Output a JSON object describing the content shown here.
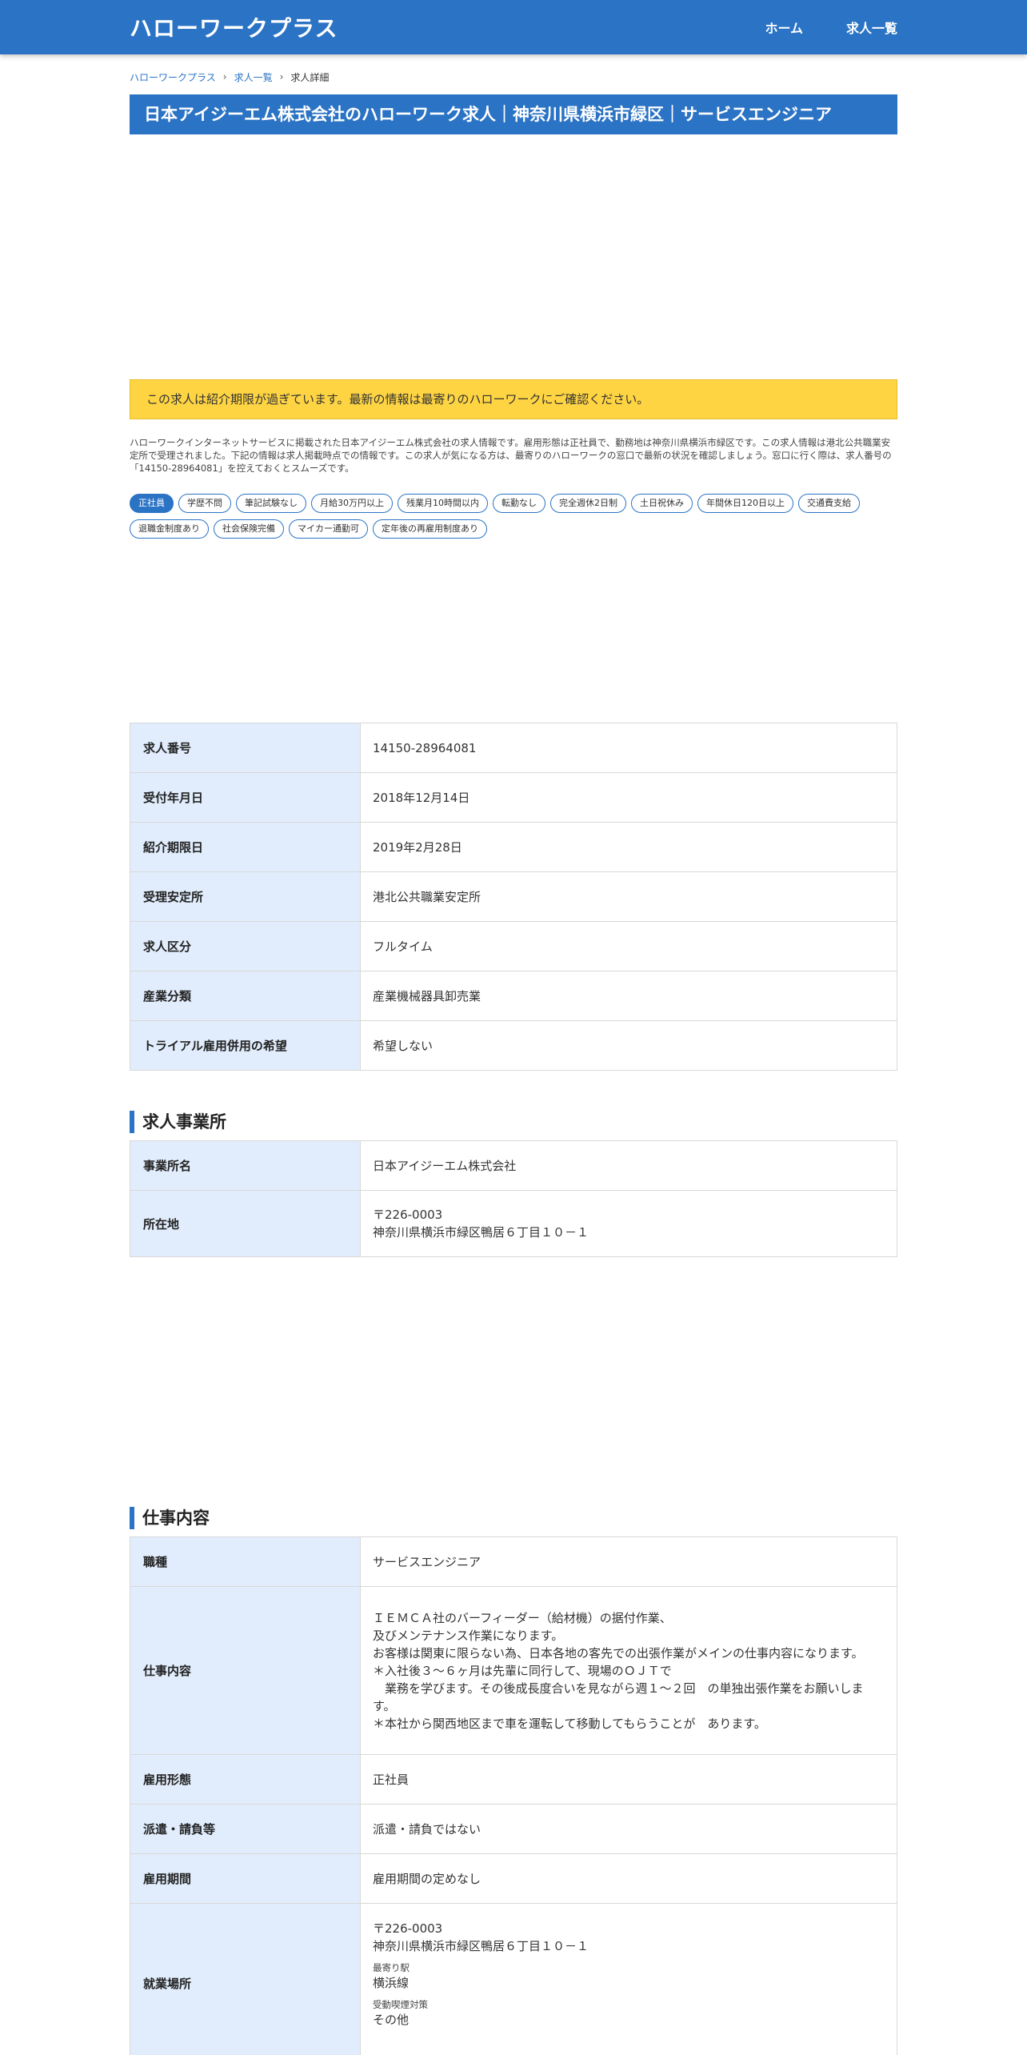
{
  "header": {
    "logo": "ハローワークプラス",
    "nav": [
      "ホーム",
      "求人一覧"
    ]
  },
  "breadcrumb": [
    "ハローワークプラス",
    "求人一覧",
    "求人詳細"
  ],
  "title": "日本アイジーエム株式会社のハローワーク求人｜神奈川県横浜市緑区｜サービスエンジニア",
  "notice": "この求人は紹介期限が過ぎています。最新の情報は最寄りのハローワークにご確認ください。",
  "intro": "ハローワークインターネットサービスに掲載された日本アイジーエム株式会社の求人情報です。雇用形態は正社員で、勤務地は神奈川県横浜市緑区です。この求人情報は港北公共職業安定所で受理されました。下記の情報は求人掲載時点での情報です。この求人が気になる方は、最寄りのハローワークの窓口で最新の状況を確認しましょう。窓口に行く際は、求人番号の「14150-28964081」を控えておくとスムーズです。",
  "tags": [
    "正社員",
    "学歴不問",
    "筆記試験なし",
    "月給30万円以上",
    "残業月10時間以内",
    "転勤なし",
    "完全週休2日制",
    "土日祝休み",
    "年間休日120日以上",
    "交通費支給",
    "退職金制度あり",
    "社会保険完備",
    "マイカー通勤可",
    "定年後の再雇用制度あり"
  ],
  "basic": [
    {
      "label": "求人番号",
      "value": "14150-28964081"
    },
    {
      "label": "受付年月日",
      "value": "2018年12月14日"
    },
    {
      "label": "紹介期限日",
      "value": "2019年2月28日"
    },
    {
      "label": "受理安定所",
      "value": "港北公共職業安定所"
    },
    {
      "label": "求人区分",
      "value": "フルタイム"
    },
    {
      "label": "産業分類",
      "value": "産業機械器具卸売業"
    },
    {
      "label": "トライアル雇用併用の希望",
      "value": "希望しない"
    }
  ],
  "office": {
    "heading": "求人事業所",
    "name_label": "事業所名",
    "name": "日本アイジーエム株式会社",
    "address_label": "所在地",
    "postal": "〒226-0003",
    "address": "神奈川県横浜市緑区鴨居６丁目１０－１"
  },
  "job": {
    "heading": "仕事内容",
    "title_label": "職種",
    "title": "サービスエンジニア",
    "desc_label": "仕事内容",
    "desc_lines": [
      "ＩＥＭＣＡ社のバーフィーダー（給材機）の据付作業、",
      "及びメンテナンス作業になります。",
      "お客様は関東に限らない為、日本各地の客先での出張作業がメインの仕事内容になります。",
      "＊入社後３～６ヶ月は先輩に同行して、現場のＯＪＴで",
      "　業務を学びます。その後成長度合いを見ながら週１～２回　の単独出張作業をお願いします。",
      "＊本社から関西地区まで車を運転して移動してもらうことが　あります。"
    ],
    "employment_label": "雇用形態",
    "employment": "正社員",
    "dispatch_label": "派遣・請負等",
    "dispatch": "派遣・請負ではない",
    "period_label": "雇用期間",
    "period": "雇用期間の定めなし",
    "workplace_label": "就業場所",
    "workplace_postal": "〒226-0003",
    "workplace_address": "神奈川県横浜市緑区鴨居６丁目１０－１",
    "station_label": "最寄り駅",
    "station": "横浜線",
    "smoking_label": "受動喫煙対策",
    "smoking": "その他"
  }
}
